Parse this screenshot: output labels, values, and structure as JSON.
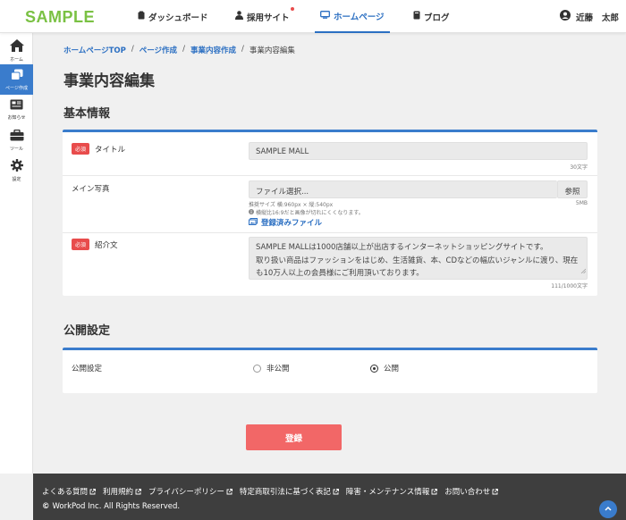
{
  "header": {
    "logo": "SAMPLE",
    "nav": [
      {
        "label": "ダッシュボード",
        "icon": "clipboard-icon"
      },
      {
        "label": "採用サイト",
        "icon": "person-tie-icon",
        "has_notification": true
      },
      {
        "label": "ホームページ",
        "icon": "monitor-icon",
        "active": true
      },
      {
        "label": "ブログ",
        "icon": "book-icon"
      }
    ],
    "user": {
      "last_name": "近藤",
      "first_name": "太郎"
    }
  },
  "sidebar": {
    "items": [
      {
        "label": "ホーム",
        "icon": "home-icon"
      },
      {
        "label": "ページ作成",
        "icon": "pages-icon",
        "active": true
      },
      {
        "label": "お知らせ",
        "icon": "news-icon"
      },
      {
        "label": "ツール",
        "icon": "toolbox-icon"
      },
      {
        "label": "設定",
        "icon": "gear-icon"
      }
    ]
  },
  "breadcrumb": {
    "items": [
      "ホームページTOP",
      "ページ作成",
      "事業内容作成",
      "事業内容編集"
    ],
    "separator": "/"
  },
  "page_title": "事業内容編集",
  "basic_info": {
    "section_title": "基本情報",
    "required_badge": "必須",
    "title_field": {
      "label": "タイトル",
      "value": "SAMPLE MALL",
      "counter": "30文字"
    },
    "photo_field": {
      "label": "メイン写真",
      "placeholder": "ファイル選択...",
      "browse_label": "参照",
      "size_limit": "5MB",
      "hint_size": "推奨サイズ 横:960px × 縦:540px",
      "hint_ratio": "横縦比16:9だと画像が切れにくくなります。",
      "uploaded_label": "登録済みファイル"
    },
    "intro_field": {
      "label": "紹介文",
      "lines": [
        "SAMPLE MALLは1000店舗以上が出店するインターネットショッピングサイトです。",
        "取り扱い商品はファッションをはじめ、生活雑貨、本、CDなどの幅広いジャンルに渡り、現在",
        "も10万人以上の会員様にご利用頂いております。"
      ],
      "counter": "111/1000文字"
    }
  },
  "publish": {
    "section_title": "公開設定",
    "label": "公開設定",
    "options": [
      {
        "label": "非公開",
        "checked": false
      },
      {
        "label": "公開",
        "checked": true
      }
    ]
  },
  "submit_label": "登録",
  "footer": {
    "links": [
      "よくある質問",
      "利用規約",
      "プライバシーポリシー",
      "特定商取引法に基づく表記",
      "障害・メンテナンス情報",
      "お問い合わせ"
    ],
    "copyright_symbol": "©",
    "copyright": "WorkPod Inc. All Rights Reserved."
  },
  "colors": {
    "accent": "#3a7ccc",
    "brand": "#7ac143",
    "danger": "#f26767",
    "footer": "#3e3e3e"
  }
}
